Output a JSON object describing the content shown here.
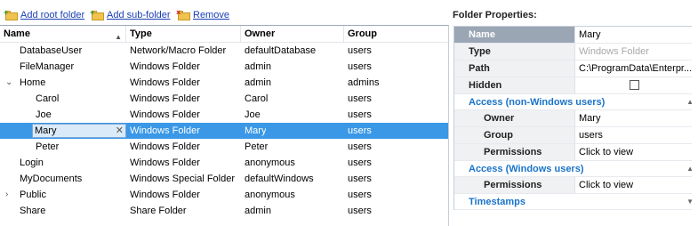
{
  "toolbar": {
    "add_root": "Add root folder",
    "add_sub": "Add sub-folder",
    "remove": "Remove"
  },
  "grid": {
    "headers": {
      "name": "Name",
      "type": "Type",
      "owner": "Owner",
      "group": "Group"
    },
    "rows": [
      {
        "name": "DatabaseUser",
        "type": "Network/Macro Folder",
        "owner": "defaultDatabase",
        "group": "users",
        "level": 0
      },
      {
        "name": "FileManager",
        "type": "Windows Folder",
        "owner": "admin",
        "group": "users",
        "level": 0
      },
      {
        "name": "Home",
        "type": "Windows Folder",
        "owner": "admin",
        "group": "admins",
        "level": 0,
        "expanded": true
      },
      {
        "name": "Carol",
        "type": "Windows Folder",
        "owner": "Carol",
        "group": "users",
        "level": 1
      },
      {
        "name": "Joe",
        "type": "Windows Folder",
        "owner": "Joe",
        "group": "users",
        "level": 1
      },
      {
        "name": "Mary",
        "type": "Windows Folder",
        "owner": "Mary",
        "group": "users",
        "level": 1,
        "selected": true
      },
      {
        "name": "Peter",
        "type": "Windows Folder",
        "owner": "Peter",
        "group": "users",
        "level": 1
      },
      {
        "name": "Login",
        "type": "Windows Folder",
        "owner": "anonymous",
        "group": "users",
        "level": 0
      },
      {
        "name": "MyDocuments",
        "type": "Windows Special Folder",
        "owner": "defaultWindows",
        "group": "users",
        "level": 0
      },
      {
        "name": "Public",
        "type": "Windows Folder",
        "owner": "anonymous",
        "group": "users",
        "level": 0,
        "collapsed": true
      },
      {
        "name": "Share",
        "type": "Share Folder",
        "owner": "admin",
        "group": "users",
        "level": 0
      }
    ]
  },
  "properties": {
    "title": "Folder Properties:",
    "name_label": "Name",
    "name_value": "Mary",
    "type_label": "Type",
    "type_value": "Windows Folder",
    "path_label": "Path",
    "path_value": "C:\\ProgramData\\Enterpr...",
    "hidden_label": "Hidden",
    "group_nonwin": "Access (non-Windows users)",
    "owner_label": "Owner",
    "owner_value": "Mary",
    "group_label": "Group",
    "group_value": "users",
    "perm_label": "Permissions",
    "perm_value": "Click to view",
    "group_win": "Access (Windows users)",
    "perm2_label": "Permissions",
    "perm2_value": "Click to view",
    "group_ts": "Timestamps"
  },
  "colors": {
    "selection": "#3a98e6",
    "link": "#1a3fb5",
    "group_header": "#1a73c9"
  }
}
